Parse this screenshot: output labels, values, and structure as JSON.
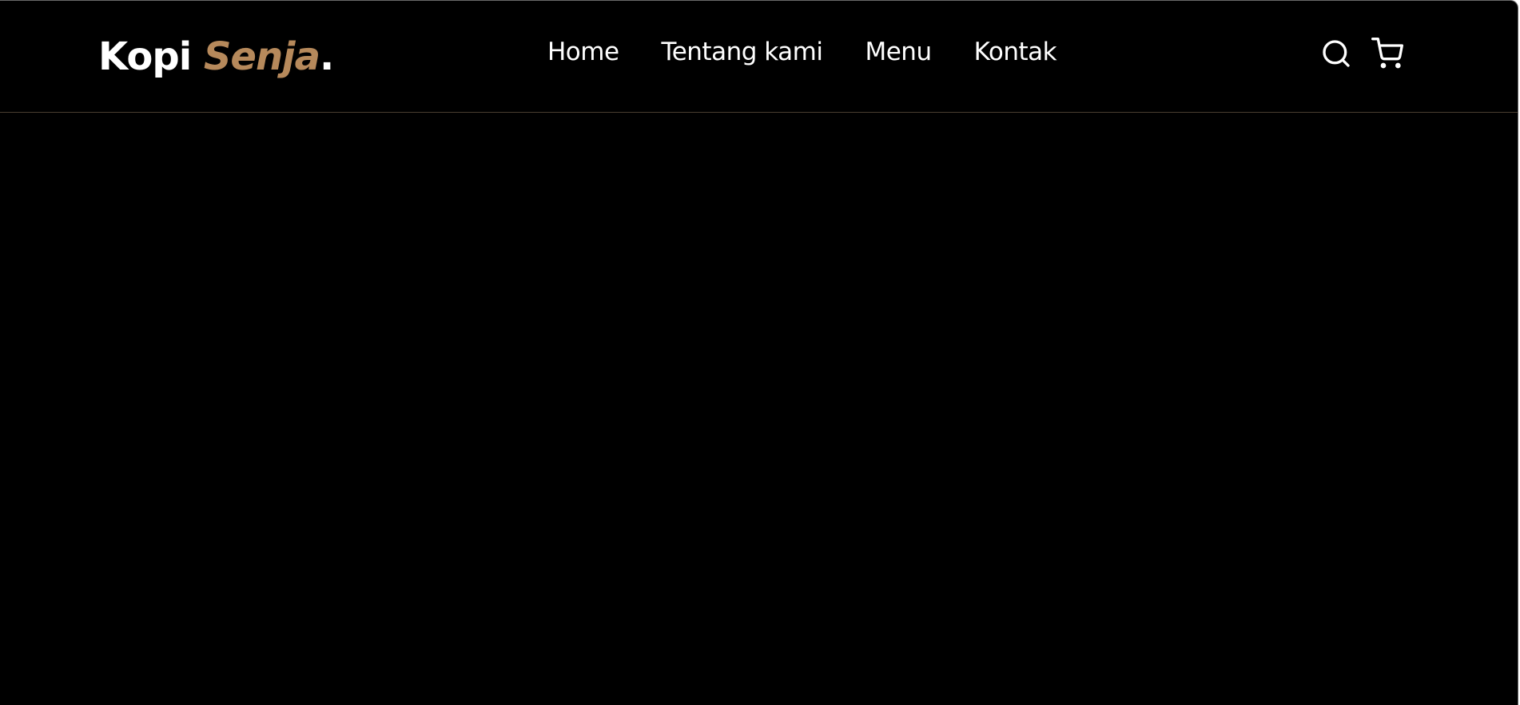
{
  "brand": {
    "name_part1": "Kopi ",
    "name_part2": "Senja",
    "name_suffix": ".",
    "accent_color": "#b6895b"
  },
  "nav": {
    "items": [
      {
        "label": "Home"
      },
      {
        "label": "Tentang kami"
      },
      {
        "label": "Menu"
      },
      {
        "label": "Kontak"
      }
    ]
  },
  "actions": {
    "search_icon": "search-icon",
    "cart_icon": "shopping-cart-icon"
  },
  "theme": {
    "background": "#000000",
    "text": "#ffffff"
  }
}
